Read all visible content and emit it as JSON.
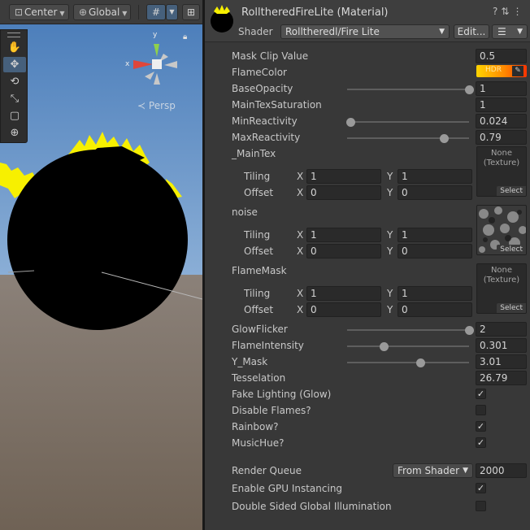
{
  "scene": {
    "toolbar": {
      "pivot_label": "Center",
      "space_label": "Global",
      "grid_snap_icon": "grid-icon",
      "increment_snap_icon": "snap-increment-icon"
    },
    "tools": [
      {
        "name": "hand-tool",
        "icon": "hand-icon",
        "glyph": "✋"
      },
      {
        "name": "move-tool",
        "icon": "move-icon",
        "glyph": "✥"
      },
      {
        "name": "rotate-tool",
        "icon": "rotate-icon",
        "glyph": "⟲"
      },
      {
        "name": "scale-tool",
        "icon": "scale-icon",
        "glyph": "⤡"
      },
      {
        "name": "rect-tool",
        "icon": "rect-icon",
        "glyph": "▢"
      },
      {
        "name": "transform-tool",
        "icon": "transform-icon",
        "glyph": "⊕"
      }
    ],
    "gizmo": {
      "x_label": "x",
      "y_label": "y",
      "persp_label": "Persp"
    },
    "colors": {
      "sky": "#5d8fc6",
      "ground": "#8a7c6e",
      "flame": "#f7f000",
      "sphere": "#000000"
    }
  },
  "inspector": {
    "title": "RolltheredFireLite (Material)",
    "shader_label": "Shader",
    "shader_value": "Rolltheredl/Fire Lite",
    "edit_label": "Edit...",
    "properties": {
      "mask_clip": {
        "label": "Mask Clip Value",
        "value": "0.5"
      },
      "flame_color": {
        "label": "FlameColor",
        "badge": "HDR"
      },
      "base_opacity": {
        "label": "BaseOpacity",
        "value": "1",
        "fraction": 1.0
      },
      "main_tex_saturation": {
        "label": "MainTexSaturation",
        "value": "1"
      },
      "min_reactivity": {
        "label": "MinReactivity",
        "value": "0.024",
        "fraction": 0.024
      },
      "max_reactivity": {
        "label": "MaxReactivity",
        "value": "0.79",
        "fraction": 0.79
      },
      "glow_flicker": {
        "label": "GlowFlicker",
        "value": "2",
        "fraction": 1.0
      },
      "flame_intensity": {
        "label": "FlameIntensity",
        "value": "0.301",
        "fraction": 0.301
      },
      "y_mask": {
        "label": "Y_Mask",
        "value": "3.01",
        "fraction": 0.6
      },
      "tesselation": {
        "label": "Tesselation",
        "value": "26.79"
      }
    },
    "textures": [
      {
        "label": "_MainTex",
        "none_text": "None\n(Texture)",
        "select": "Select",
        "tiling_label": "Tiling",
        "offset_label": "Offset",
        "x": "X",
        "y": "Y",
        "tiling_x": "1",
        "tiling_y": "1",
        "offset_x": "0",
        "offset_y": "0",
        "has_image": false
      },
      {
        "label": "noise",
        "none_text": "",
        "select": "Select",
        "tiling_label": "Tiling",
        "offset_label": "Offset",
        "x": "X",
        "y": "Y",
        "tiling_x": "1",
        "tiling_y": "1",
        "offset_x": "0",
        "offset_y": "0",
        "has_image": true
      },
      {
        "label": "FlameMask",
        "none_text": "None\n(Texture)",
        "select": "Select",
        "tiling_label": "Tiling",
        "offset_label": "Offset",
        "x": "X",
        "y": "Y",
        "tiling_x": "1",
        "tiling_y": "1",
        "offset_x": "0",
        "offset_y": "0",
        "has_image": false
      }
    ],
    "toggles": [
      {
        "label": "Fake Lighting (Glow)",
        "checked": true
      },
      {
        "label": "Disable Flames?",
        "checked": false
      },
      {
        "label": "Rainbow?",
        "checked": true
      },
      {
        "label": "MusicHue?",
        "checked": true
      }
    ],
    "render_queue": {
      "label": "Render Queue",
      "mode": "From Shader",
      "value": "2000"
    },
    "gpu_instancing": {
      "label": "Enable GPU Instancing",
      "checked": true
    },
    "double_sided_gi": {
      "label": "Double Sided Global Illumination",
      "checked": false
    }
  }
}
